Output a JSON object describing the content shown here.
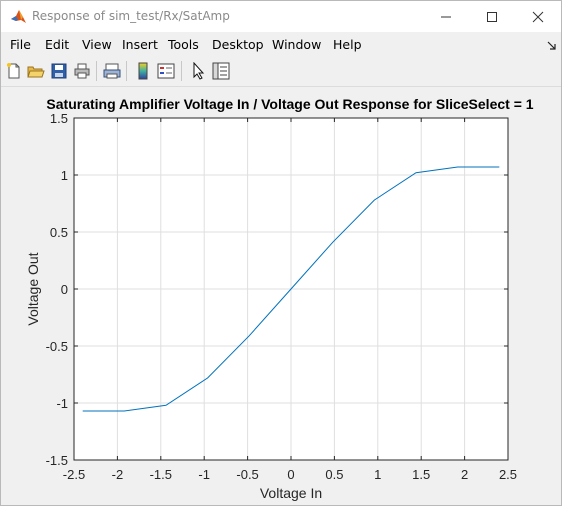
{
  "window": {
    "title": "Response of sim_test/Rx/SatAmp"
  },
  "menu": {
    "items": [
      "File",
      "Edit",
      "View",
      "Insert",
      "Tools",
      "Desktop",
      "Window",
      "Help"
    ]
  },
  "toolbar": {
    "icons": [
      "new-figure-icon",
      "open-file-icon",
      "save-icon",
      "print-icon",
      "print-preview-icon",
      "colorbar-icon",
      "legend-icon",
      "edit-plot-pointer-icon",
      "property-inspector-icon"
    ]
  },
  "chart_data": {
    "type": "line",
    "title": "Saturating Amplifier Voltage In / Voltage Out Response for SliceSelect = 1",
    "xlabel": "Voltage In",
    "ylabel": "Voltage Out",
    "xlim": [
      -2.5,
      2.5
    ],
    "ylim": [
      -1.5,
      1.5
    ],
    "xticks": [
      "-2.5",
      "-2",
      "-1.5",
      "-1",
      "-0.5",
      "0",
      "0.5",
      "1",
      "1.5",
      "2",
      "2.5"
    ],
    "yticks": [
      "1.5",
      "1",
      "0.5",
      "0",
      "-0.5",
      "-1",
      "-1.5"
    ],
    "grid": true,
    "series": [
      {
        "color": "#0072bd",
        "x": [
          -2.4,
          -1.92,
          -1.44,
          -0.96,
          -0.48,
          0,
          0.48,
          0.96,
          1.44,
          1.92,
          2.4
        ],
        "y": [
          -1.07,
          -1.07,
          -1.02,
          -0.78,
          -0.41,
          0,
          0.41,
          0.78,
          1.02,
          1.07,
          1.07
        ]
      }
    ]
  }
}
